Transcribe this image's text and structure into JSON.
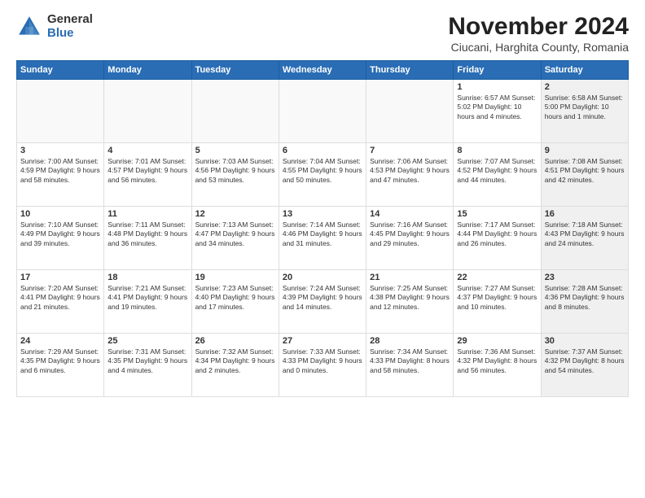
{
  "logo": {
    "general": "General",
    "blue": "Blue"
  },
  "title": "November 2024",
  "location": "Ciucani, Harghita County, Romania",
  "weekdays": [
    "Sunday",
    "Monday",
    "Tuesday",
    "Wednesday",
    "Thursday",
    "Friday",
    "Saturday"
  ],
  "weeks": [
    [
      {
        "day": "",
        "info": ""
      },
      {
        "day": "",
        "info": ""
      },
      {
        "day": "",
        "info": ""
      },
      {
        "day": "",
        "info": ""
      },
      {
        "day": "",
        "info": ""
      },
      {
        "day": "1",
        "info": "Sunrise: 6:57 AM\nSunset: 5:02 PM\nDaylight: 10 hours\nand 4 minutes."
      },
      {
        "day": "2",
        "info": "Sunrise: 6:58 AM\nSunset: 5:00 PM\nDaylight: 10 hours\nand 1 minute."
      }
    ],
    [
      {
        "day": "3",
        "info": "Sunrise: 7:00 AM\nSunset: 4:59 PM\nDaylight: 9 hours\nand 58 minutes."
      },
      {
        "day": "4",
        "info": "Sunrise: 7:01 AM\nSunset: 4:57 PM\nDaylight: 9 hours\nand 56 minutes."
      },
      {
        "day": "5",
        "info": "Sunrise: 7:03 AM\nSunset: 4:56 PM\nDaylight: 9 hours\nand 53 minutes."
      },
      {
        "day": "6",
        "info": "Sunrise: 7:04 AM\nSunset: 4:55 PM\nDaylight: 9 hours\nand 50 minutes."
      },
      {
        "day": "7",
        "info": "Sunrise: 7:06 AM\nSunset: 4:53 PM\nDaylight: 9 hours\nand 47 minutes."
      },
      {
        "day": "8",
        "info": "Sunrise: 7:07 AM\nSunset: 4:52 PM\nDaylight: 9 hours\nand 44 minutes."
      },
      {
        "day": "9",
        "info": "Sunrise: 7:08 AM\nSunset: 4:51 PM\nDaylight: 9 hours\nand 42 minutes."
      }
    ],
    [
      {
        "day": "10",
        "info": "Sunrise: 7:10 AM\nSunset: 4:49 PM\nDaylight: 9 hours\nand 39 minutes."
      },
      {
        "day": "11",
        "info": "Sunrise: 7:11 AM\nSunset: 4:48 PM\nDaylight: 9 hours\nand 36 minutes."
      },
      {
        "day": "12",
        "info": "Sunrise: 7:13 AM\nSunset: 4:47 PM\nDaylight: 9 hours\nand 34 minutes."
      },
      {
        "day": "13",
        "info": "Sunrise: 7:14 AM\nSunset: 4:46 PM\nDaylight: 9 hours\nand 31 minutes."
      },
      {
        "day": "14",
        "info": "Sunrise: 7:16 AM\nSunset: 4:45 PM\nDaylight: 9 hours\nand 29 minutes."
      },
      {
        "day": "15",
        "info": "Sunrise: 7:17 AM\nSunset: 4:44 PM\nDaylight: 9 hours\nand 26 minutes."
      },
      {
        "day": "16",
        "info": "Sunrise: 7:18 AM\nSunset: 4:43 PM\nDaylight: 9 hours\nand 24 minutes."
      }
    ],
    [
      {
        "day": "17",
        "info": "Sunrise: 7:20 AM\nSunset: 4:41 PM\nDaylight: 9 hours\nand 21 minutes."
      },
      {
        "day": "18",
        "info": "Sunrise: 7:21 AM\nSunset: 4:41 PM\nDaylight: 9 hours\nand 19 minutes."
      },
      {
        "day": "19",
        "info": "Sunrise: 7:23 AM\nSunset: 4:40 PM\nDaylight: 9 hours\nand 17 minutes."
      },
      {
        "day": "20",
        "info": "Sunrise: 7:24 AM\nSunset: 4:39 PM\nDaylight: 9 hours\nand 14 minutes."
      },
      {
        "day": "21",
        "info": "Sunrise: 7:25 AM\nSunset: 4:38 PM\nDaylight: 9 hours\nand 12 minutes."
      },
      {
        "day": "22",
        "info": "Sunrise: 7:27 AM\nSunset: 4:37 PM\nDaylight: 9 hours\nand 10 minutes."
      },
      {
        "day": "23",
        "info": "Sunrise: 7:28 AM\nSunset: 4:36 PM\nDaylight: 9 hours\nand 8 minutes."
      }
    ],
    [
      {
        "day": "24",
        "info": "Sunrise: 7:29 AM\nSunset: 4:35 PM\nDaylight: 9 hours\nand 6 minutes."
      },
      {
        "day": "25",
        "info": "Sunrise: 7:31 AM\nSunset: 4:35 PM\nDaylight: 9 hours\nand 4 minutes."
      },
      {
        "day": "26",
        "info": "Sunrise: 7:32 AM\nSunset: 4:34 PM\nDaylight: 9 hours\nand 2 minutes."
      },
      {
        "day": "27",
        "info": "Sunrise: 7:33 AM\nSunset: 4:33 PM\nDaylight: 9 hours\nand 0 minutes."
      },
      {
        "day": "28",
        "info": "Sunrise: 7:34 AM\nSunset: 4:33 PM\nDaylight: 8 hours\nand 58 minutes."
      },
      {
        "day": "29",
        "info": "Sunrise: 7:36 AM\nSunset: 4:32 PM\nDaylight: 8 hours\nand 56 minutes."
      },
      {
        "day": "30",
        "info": "Sunrise: 7:37 AM\nSunset: 4:32 PM\nDaylight: 8 hours\nand 54 minutes."
      }
    ]
  ]
}
